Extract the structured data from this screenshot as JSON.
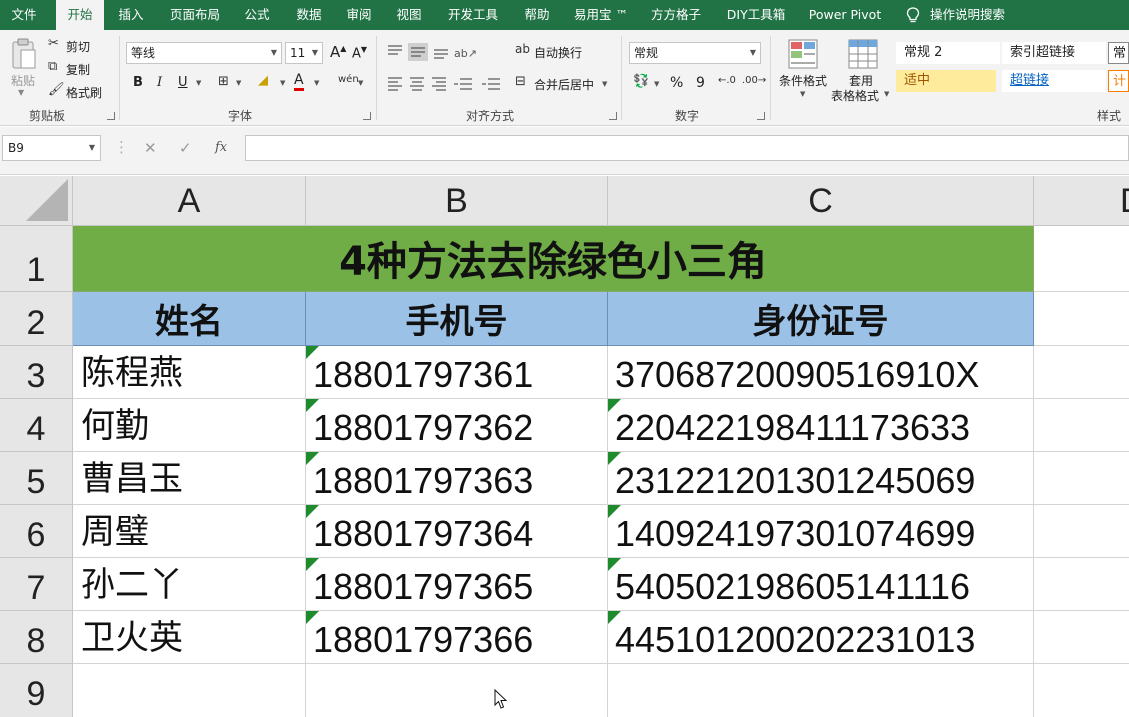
{
  "ribbon_tabs": [
    {
      "label": "文件",
      "active": false
    },
    {
      "label": "开始",
      "active": true
    },
    {
      "label": "插入",
      "active": false
    },
    {
      "label": "页面布局",
      "active": false
    },
    {
      "label": "公式",
      "active": false
    },
    {
      "label": "数据",
      "active": false
    },
    {
      "label": "审阅",
      "active": false
    },
    {
      "label": "视图",
      "active": false
    },
    {
      "label": "开发工具",
      "active": false
    },
    {
      "label": "帮助",
      "active": false
    },
    {
      "label": "易用宝 ™",
      "active": false
    },
    {
      "label": "方方格子",
      "active": false
    },
    {
      "label": "DIY工具箱",
      "active": false
    },
    {
      "label": "Power Pivot",
      "active": false
    },
    {
      "label": "操作说明搜索",
      "active": false
    }
  ],
  "clipboard": {
    "paste": "粘贴",
    "cut": "剪切",
    "copy": "复制",
    "format_painter": "格式刷",
    "group_label": "剪贴板"
  },
  "font": {
    "name": "等线",
    "size": "11",
    "bold": "B",
    "italic": "I",
    "underline": "U",
    "phonetic": "wén",
    "group_label": "字体",
    "grow": "A",
    "shrink": "A",
    "font_color": "A"
  },
  "alignment": {
    "wrap_text": "自动换行",
    "merge_center": "合并后居中",
    "group_label": "对齐方式"
  },
  "number": {
    "format": "常规",
    "percent": "%",
    "comma": "9",
    "group_label": "数字"
  },
  "styles": {
    "conditional_format": "条件格式",
    "table_format_1": "套用",
    "table_format_2": "表格格式",
    "cells": [
      {
        "label": "常规 2",
        "bg": "#ffffff",
        "color": "#222222"
      },
      {
        "label": "索引超链接",
        "bg": "#ffffff",
        "color": "#222222"
      },
      {
        "label": "适中",
        "bg": "#ffeb9c",
        "color": "#9c5700"
      },
      {
        "label": "超链接",
        "bg": "#ffffff",
        "color": "#0563c1"
      },
      {
        "label": "常",
        "bg": "#ffffff",
        "color": "#222222"
      },
      {
        "label": "计",
        "bg": "#ffffff",
        "color": "#fa7d00"
      }
    ],
    "group_label": "样式"
  },
  "formula_bar": {
    "name_box": "B9",
    "cancel": "✕",
    "enter": "✓",
    "fx": "fx",
    "value": ""
  },
  "sheet": {
    "columns": [
      "A",
      "B",
      "C",
      "D"
    ],
    "rows": [
      "1",
      "2",
      "3",
      "4",
      "5",
      "6",
      "7",
      "8",
      "9"
    ],
    "title": "4种方法去除绿色小三角",
    "title_bg": "#70ad47",
    "header_bg": "#9bc2e6",
    "triangle_color": "#1e8b2d",
    "headers": [
      "姓名",
      "手机号",
      "身份证号"
    ],
    "records": [
      {
        "name": "陈程燕",
        "phone": "18801797361",
        "id": "37068720090516910X"
      },
      {
        "name": "何勤",
        "phone": "18801797362",
        "id": "220422198411173633"
      },
      {
        "name": "曹昌玉",
        "phone": "18801797363",
        "id": "231221201301245069"
      },
      {
        "name": "周璧",
        "phone": "18801797364",
        "id": "140924197301074699"
      },
      {
        "name": "孙二丫",
        "phone": "18801797365",
        "id": "540502198605141116"
      },
      {
        "name": "卫火英",
        "phone": "18801797366",
        "id": "445101200202231013"
      }
    ]
  }
}
